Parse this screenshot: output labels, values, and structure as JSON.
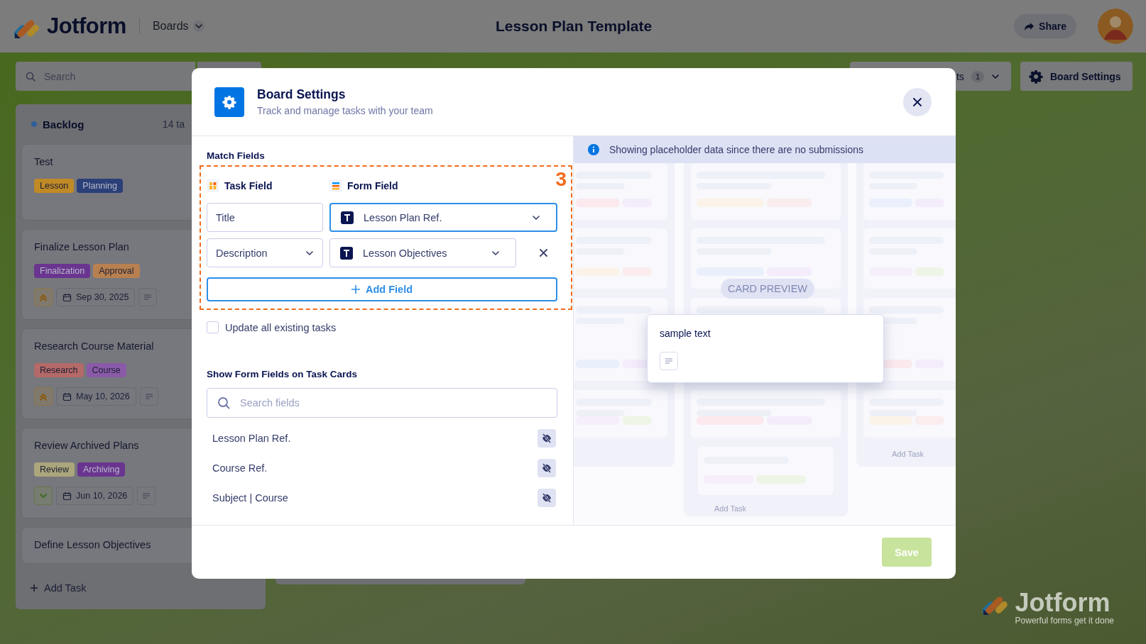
{
  "topbar": {
    "logo_text": "Jotform",
    "boards_menu": "Boards",
    "title": "Lesson Plan Template",
    "share_button": "Share"
  },
  "toolbar": {
    "search_placeholder": "Search",
    "filter_label": "ts",
    "filter_count": "1",
    "settings_button": "Board Settings"
  },
  "columns": [
    {
      "title": "Backlog",
      "color": "#2f5f9a",
      "count": "14 ta",
      "add_task": "Add Task",
      "cards": [
        {
          "title": "Test",
          "kind": "plain",
          "tags": [
            {
              "label": "Lesson",
              "color": "#c08a26"
            },
            {
              "label": "Planning",
              "color": "#2b3f78"
            }
          ]
        },
        {
          "title": "Finalize Lesson Plan",
          "tags": [
            {
              "label": "Finalization",
              "color": "#6a3590"
            },
            {
              "label": "Approval",
              "color": "#b88050"
            }
          ],
          "kind": "high_priority",
          "date": "Sep 30, 2025"
        },
        {
          "title": "Research Course Material",
          "tags": [
            {
              "label": "Research",
              "color": "#b46a68"
            },
            {
              "label": "Course",
              "color": "#8a5aa8"
            }
          ],
          "kind": "high_priority",
          "date": "May 10, 2026"
        },
        {
          "title": "Review Archived Plans",
          "tags": [
            {
              "label": "Review",
              "color": "#aca67c"
            },
            {
              "label": "Archiving",
              "color": "#6a3590"
            }
          ],
          "kind": "low_priority",
          "date": "Jun 10, 2026"
        },
        {
          "title": "Define Lesson Objectives",
          "kind": "plain"
        }
      ]
    }
  ],
  "modal": {
    "title": "Board Settings",
    "subtitle": "Track and manage tasks with your team",
    "match_fields": {
      "heading": "Match Fields",
      "task_field_heading": "Task Field",
      "form_field_heading": "Form Field",
      "step_marker": "3",
      "rows": [
        {
          "task_field": "Title",
          "kind": "fixed",
          "form_field": "Lesson Plan Ref.",
          "focused": true,
          "removable": false
        },
        {
          "task_field": "Description",
          "kind": "select",
          "form_field": "Lesson Objectives",
          "focused": false,
          "removable": true
        }
      ],
      "add_button": "Add Field"
    },
    "update_existing": {
      "label": "Update all existing tasks",
      "checked": false
    },
    "show_fields": {
      "heading": "Show Form Fields on Task Cards",
      "search_placeholder": "Search fields",
      "items": [
        {
          "label": "Lesson Plan Ref.",
          "visible": false
        },
        {
          "label": "Course Ref.",
          "visible": false
        },
        {
          "label": "Subject | Course",
          "visible": false
        }
      ]
    },
    "preview": {
      "notice": "Showing placeholder data since there are no submissions",
      "badge": "CARD PREVIEW",
      "card_title": "sample text",
      "add_task_labels": [
        "Add Task",
        "Add Task"
      ]
    },
    "save_button": {
      "label": "Save",
      "disabled": true
    }
  },
  "branding": {
    "name": "Jotform",
    "tagline": "Powerful forms get it done"
  }
}
